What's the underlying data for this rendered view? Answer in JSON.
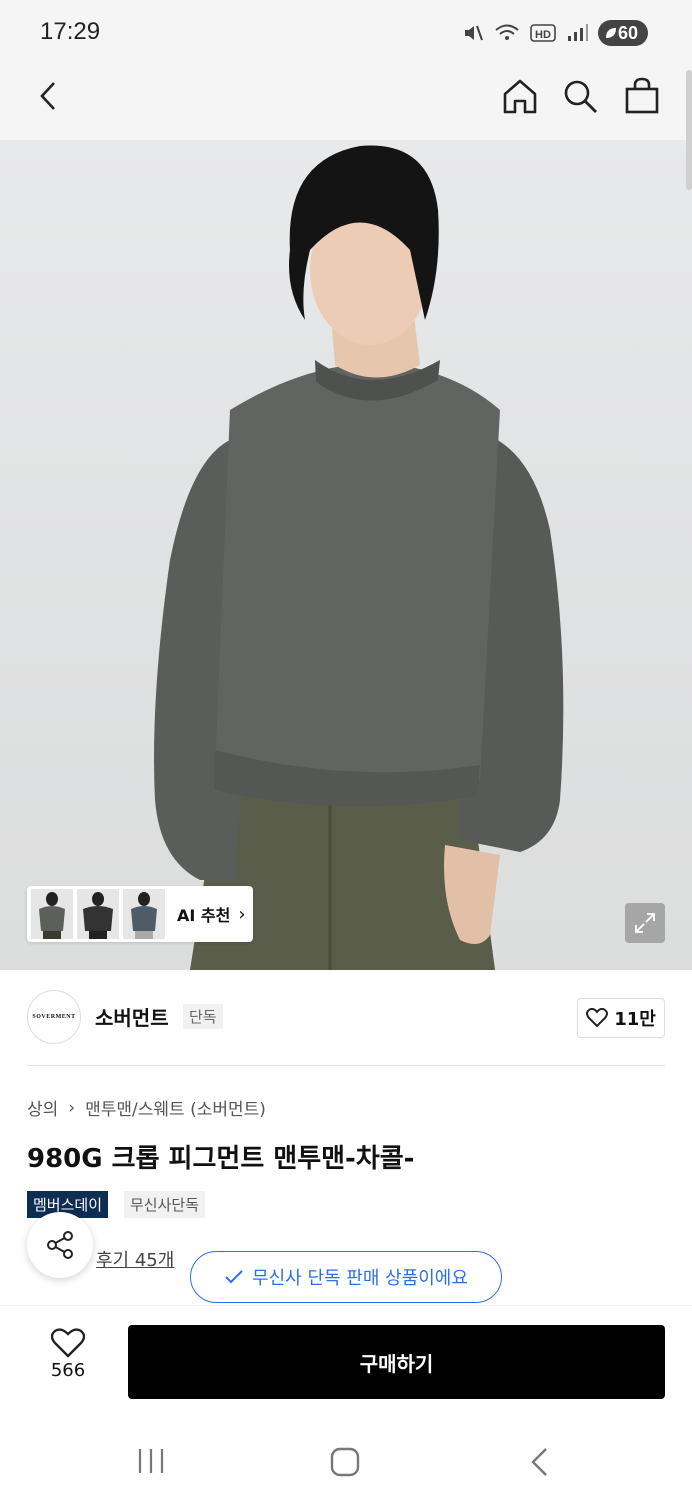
{
  "status_bar": {
    "time": "17:29",
    "battery": "60"
  },
  "nav": {
    "back": "back-icon",
    "home": "home-icon",
    "search": "search-icon",
    "cart": "bag-icon"
  },
  "hero": {
    "ai_label": "AI 추천",
    "ai_arrow": "›"
  },
  "brand": {
    "name": "소버먼트",
    "tag": "단독",
    "logo_text": "SOVERMENT",
    "likes": "11만"
  },
  "breadcrumb": {
    "category": "상의",
    "separator": "›",
    "sub": "맨투맨/스웨트 (소버먼트)"
  },
  "product": {
    "title": "980G 크롭 피그먼트 맨투맨-차콜-"
  },
  "badges": {
    "member": "멤버스데이",
    "exclusive": "무신사단독"
  },
  "review": {
    "text": "후기 45개"
  },
  "toast": {
    "text": "무신사 단독 판매 상품이에요"
  },
  "bottom": {
    "wish_count": "566",
    "buy_label": "구매하기"
  },
  "colors": {
    "accent_blue": "#2e6fe8",
    "badge_navy": "#0e2d53",
    "buy_black": "#000000"
  }
}
